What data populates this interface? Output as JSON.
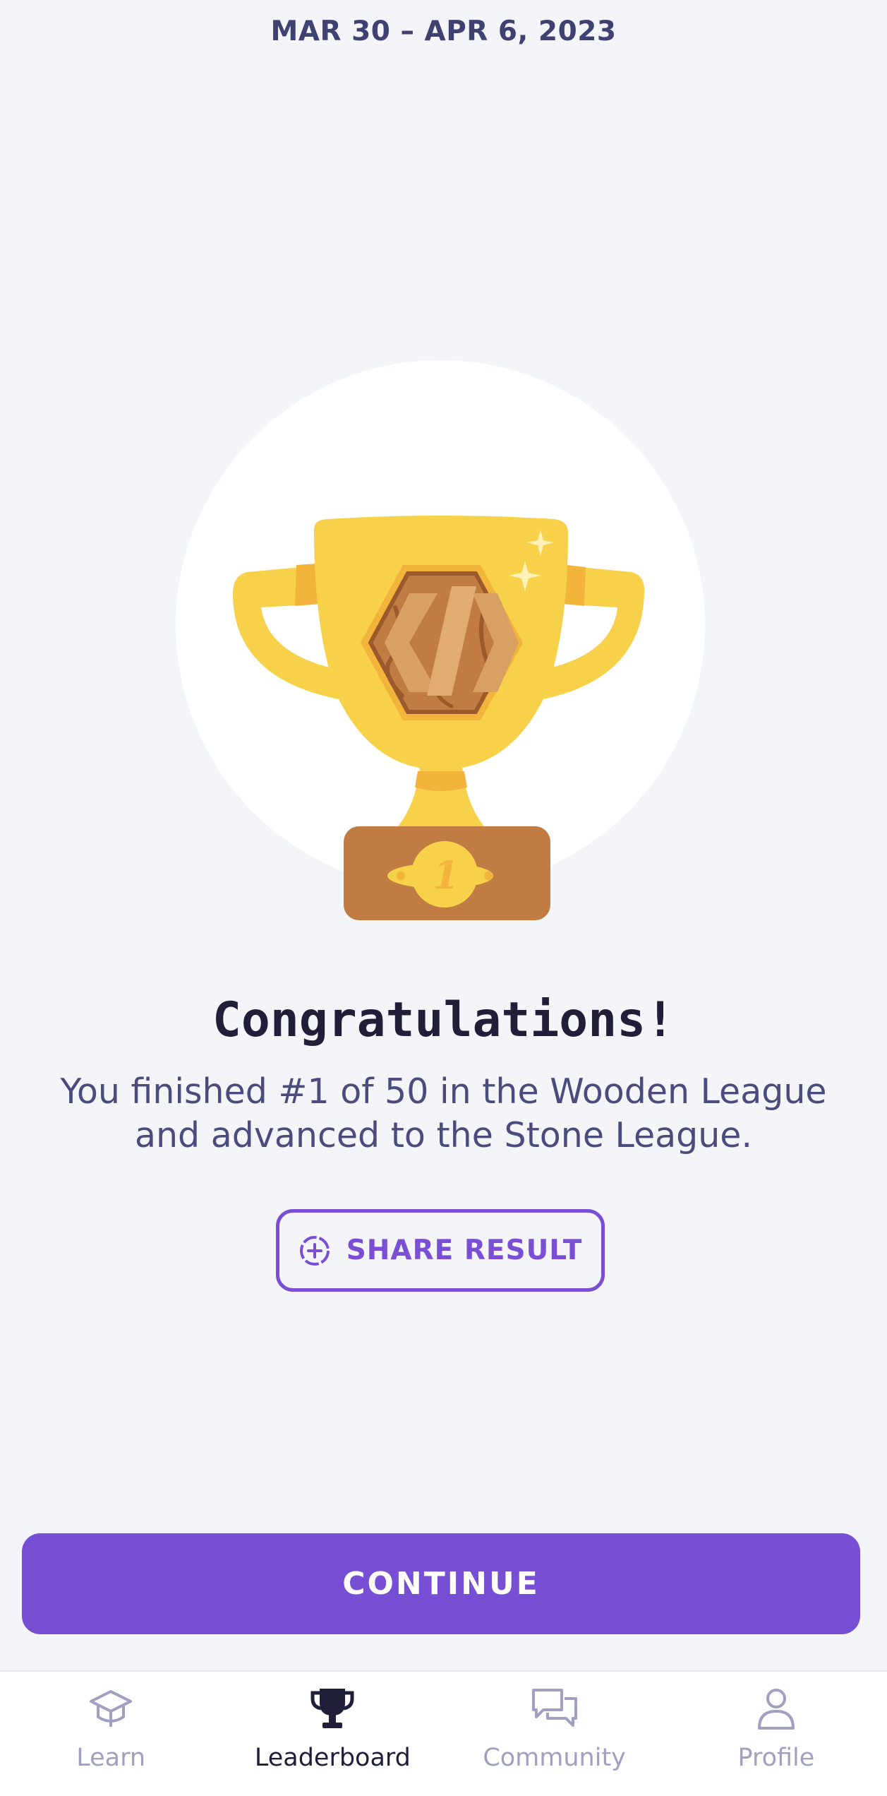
{
  "header": {
    "date_range": "MAR 30 – APR 6, 2023"
  },
  "trophy": {
    "rank_badge": "1",
    "colors": {
      "circle": "#ffffff",
      "gold": "#f7d14a",
      "gold_dark": "#f2b43a",
      "wood": "#c17c44",
      "wood_light": "#d9a063",
      "wood_dark": "#9b5a2c"
    }
  },
  "result": {
    "title": "Congratulations!",
    "message": "You finished #1 of 50 in the Wooden League and advanced to the Stone League."
  },
  "actions": {
    "share_label": "SHARE RESULT",
    "continue_label": "CONTINUE"
  },
  "tabbar": {
    "items": [
      {
        "label": "Learn",
        "icon": "graduation-cap-icon",
        "active": false
      },
      {
        "label": "Leaderboard",
        "icon": "trophy-icon",
        "active": true
      },
      {
        "label": "Community",
        "icon": "chat-bubbles-icon",
        "active": false
      },
      {
        "label": "Profile",
        "icon": "person-icon",
        "active": false
      }
    ]
  },
  "colors": {
    "accent": "#774fd4",
    "background": "#f4f5f9",
    "text_dark": "#1f1f3a",
    "text_muted": "#4a4c7d",
    "tab_inactive": "#a0a1c0"
  }
}
